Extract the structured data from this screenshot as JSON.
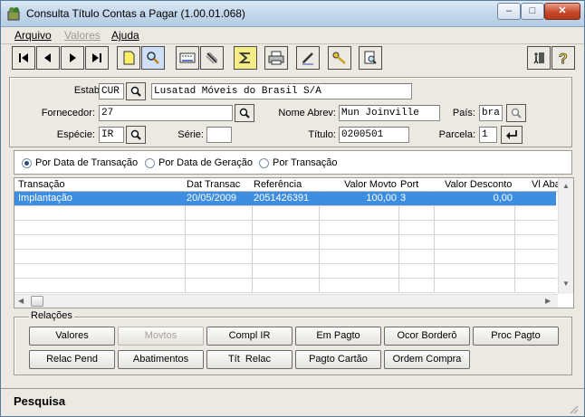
{
  "window": {
    "title": "Consulta Título Contas a Pagar (1.00.01.068)"
  },
  "menu": [
    {
      "label": "Arquivo",
      "disabled": false
    },
    {
      "label": "Valores",
      "disabled": true
    },
    {
      "label": "Ajuda",
      "disabled": false
    }
  ],
  "toolbar": {
    "icons": [
      "first-icon",
      "prev-icon",
      "next-icon",
      "last-icon",
      "new-icon",
      "search-icon",
      "goto-icon",
      "filter-icon",
      "sum-icon",
      "print-icon",
      "edit-icon",
      "keys-icon",
      "query-icon",
      "exit-icon",
      "help-icon"
    ]
  },
  "header": {
    "estab_label": "Estab:",
    "estab_value": "CUR",
    "estab_name": "Lusatad Móveis do Brasil S/A",
    "fornecedor_label": "Fornecedor:",
    "fornecedor_value": "27",
    "nome_abrev_label": "Nome Abrev:",
    "nome_abrev_value": "Mun Joinville",
    "pais_label": "País:",
    "pais_value": "bra",
    "especie_label": "Espécie:",
    "especie_value": "IR",
    "serie_label": "Série:",
    "serie_value": "",
    "titulo_label": "Título:",
    "titulo_value": "0200501",
    "parcela_label": "Parcela:",
    "parcela_value": "1"
  },
  "radios": [
    {
      "label": "Por Data de Transação",
      "checked": true
    },
    {
      "label": "Por Data de Geração",
      "checked": false
    },
    {
      "label": "Por Transação",
      "checked": false
    }
  ],
  "grid": {
    "columns": [
      "Transação",
      "Dat Transac",
      "Referência",
      "Valor Movto",
      "Port",
      "Valor Desconto",
      "Vl Aba"
    ],
    "rows": [
      [
        "Implantação",
        "20/05/2009",
        "2051426391",
        "100,00",
        "3",
        "0,00",
        ""
      ]
    ]
  },
  "relacoes": {
    "title": "Relações",
    "buttons_row1": [
      {
        "label": "Valores",
        "disabled": false
      },
      {
        "label": "Movtos",
        "disabled": true
      },
      {
        "label": "Compl IR",
        "disabled": false
      },
      {
        "label": "Em Pagto",
        "disabled": false
      },
      {
        "label": "Ocor Borderô",
        "disabled": false
      },
      {
        "label": "Proc Pagto",
        "disabled": false
      }
    ],
    "buttons_row2": [
      {
        "label": "Relac Pend",
        "disabled": false
      },
      {
        "label": "Abatimentos",
        "disabled": false
      },
      {
        "label": "Tít  Relac",
        "disabled": false
      },
      {
        "label": "Pagto Cartão",
        "disabled": false
      },
      {
        "label": "Ordem Compra",
        "disabled": false
      }
    ]
  },
  "status": {
    "text": "Pesquisa"
  }
}
